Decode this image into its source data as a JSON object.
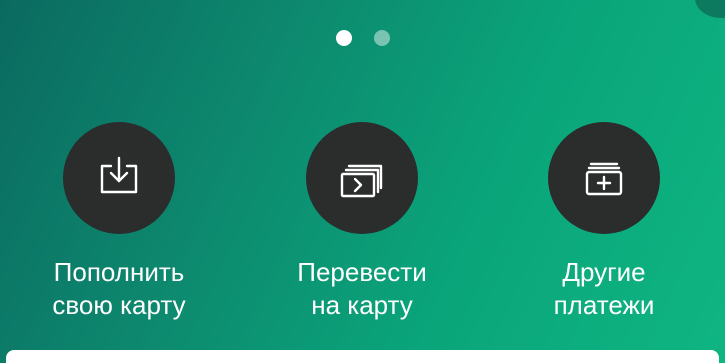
{
  "carousel": {
    "pages": 2,
    "active_index": 0
  },
  "actions": [
    {
      "icon": "download-icon",
      "line1": "Пополнить",
      "line2": "свою карту"
    },
    {
      "icon": "transfer-cards-icon",
      "line1": "Перевести",
      "line2": "на карту"
    },
    {
      "icon": "add-payment-icon",
      "line1": "Другие",
      "line2": "платежи"
    }
  ],
  "colors": {
    "gradient_start": "#0b6a60",
    "gradient_end": "#0fb582",
    "circle_bg": "#2b2c2c",
    "text": "#ffffff"
  }
}
